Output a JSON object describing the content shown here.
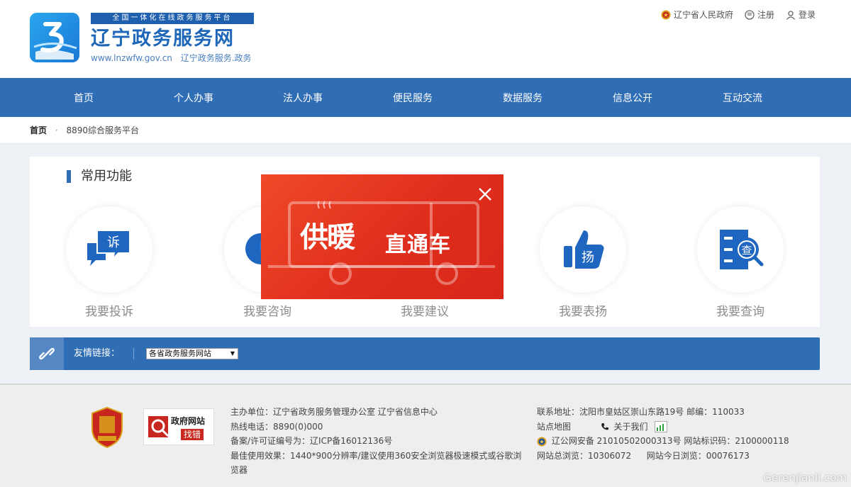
{
  "header": {
    "slogan": "全国一体化在线政务服务平台",
    "site_name": "辽宁政务服务网",
    "url_text": "www.lnzwfw.gov.cn",
    "url_cn": "辽宁政务服务.政务",
    "top_links": {
      "gov": "辽宁省人民政府",
      "register": "注册",
      "login": "登录"
    }
  },
  "nav": {
    "items": [
      "首页",
      "个人办事",
      "法人办事",
      "便民服务",
      "数据服务",
      "信息公开",
      "互动交流"
    ]
  },
  "breadcrumb": {
    "home": "首页",
    "separator": "·",
    "current": "8890综合服务平台"
  },
  "functions": {
    "title": "常用功能",
    "items": [
      {
        "label": "我要投诉",
        "icon": "complaint-chat-icon",
        "glyph": "诉"
      },
      {
        "label": "我要咨询",
        "icon": "consult-chat-icon"
      },
      {
        "label": "我要建议",
        "icon": "suggest-icon"
      },
      {
        "label": "我要表扬",
        "icon": "thumbs-up-icon",
        "glyph": "扬"
      },
      {
        "label": "我要查询",
        "icon": "query-search-icon",
        "glyph": "查"
      }
    ]
  },
  "links_bar": {
    "label": "友情链接：",
    "select_value": "各省政务服务网站"
  },
  "popup": {
    "title_part1": "供暖",
    "title_part2": "直通车"
  },
  "footer": {
    "report_title": "政府网站",
    "report_action": "找错",
    "col1": [
      "主办单位：辽宁省政务服务管理办公室   辽宁省信息中心",
      "热线电话：8890(0)000",
      "备案/许可证编号为：辽ICP备16012136号",
      "最佳使用效果：1440*900分辨率/建议使用360安全浏览器极速模式或谷歌浏览器"
    ],
    "col2": {
      "address": "联系地址：沈阳市皇姑区崇山东路19号   邮编：110033",
      "sitemap": "站点地图",
      "about": "关于我们",
      "police": "辽公网安备 21010502000313号  网站标识码：2100000118",
      "visits_total": "网站总浏览：10306072",
      "visits_today": "网站今日浏览：00076173"
    },
    "watermark": "Gerenjianli.com"
  },
  "colors": {
    "nav_blue": "#2f6db5",
    "popup_red": "#e02e1c",
    "icon_blue": "#1f66c1"
  }
}
